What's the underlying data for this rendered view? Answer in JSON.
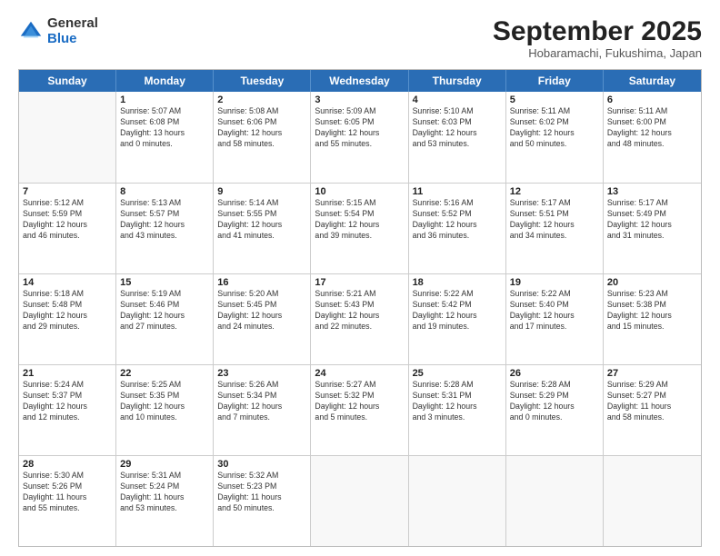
{
  "logo": {
    "general": "General",
    "blue": "Blue"
  },
  "title": "September 2025",
  "subtitle": "Hobaramachi, Fukushima, Japan",
  "weekdays": [
    "Sunday",
    "Monday",
    "Tuesday",
    "Wednesday",
    "Thursday",
    "Friday",
    "Saturday"
  ],
  "weeks": [
    [
      {
        "day": "",
        "info": ""
      },
      {
        "day": "1",
        "info": "Sunrise: 5:07 AM\nSunset: 6:08 PM\nDaylight: 13 hours\nand 0 minutes."
      },
      {
        "day": "2",
        "info": "Sunrise: 5:08 AM\nSunset: 6:06 PM\nDaylight: 12 hours\nand 58 minutes."
      },
      {
        "day": "3",
        "info": "Sunrise: 5:09 AM\nSunset: 6:05 PM\nDaylight: 12 hours\nand 55 minutes."
      },
      {
        "day": "4",
        "info": "Sunrise: 5:10 AM\nSunset: 6:03 PM\nDaylight: 12 hours\nand 53 minutes."
      },
      {
        "day": "5",
        "info": "Sunrise: 5:11 AM\nSunset: 6:02 PM\nDaylight: 12 hours\nand 50 minutes."
      },
      {
        "day": "6",
        "info": "Sunrise: 5:11 AM\nSunset: 6:00 PM\nDaylight: 12 hours\nand 48 minutes."
      }
    ],
    [
      {
        "day": "7",
        "info": "Sunrise: 5:12 AM\nSunset: 5:59 PM\nDaylight: 12 hours\nand 46 minutes."
      },
      {
        "day": "8",
        "info": "Sunrise: 5:13 AM\nSunset: 5:57 PM\nDaylight: 12 hours\nand 43 minutes."
      },
      {
        "day": "9",
        "info": "Sunrise: 5:14 AM\nSunset: 5:55 PM\nDaylight: 12 hours\nand 41 minutes."
      },
      {
        "day": "10",
        "info": "Sunrise: 5:15 AM\nSunset: 5:54 PM\nDaylight: 12 hours\nand 39 minutes."
      },
      {
        "day": "11",
        "info": "Sunrise: 5:16 AM\nSunset: 5:52 PM\nDaylight: 12 hours\nand 36 minutes."
      },
      {
        "day": "12",
        "info": "Sunrise: 5:17 AM\nSunset: 5:51 PM\nDaylight: 12 hours\nand 34 minutes."
      },
      {
        "day": "13",
        "info": "Sunrise: 5:17 AM\nSunset: 5:49 PM\nDaylight: 12 hours\nand 31 minutes."
      }
    ],
    [
      {
        "day": "14",
        "info": "Sunrise: 5:18 AM\nSunset: 5:48 PM\nDaylight: 12 hours\nand 29 minutes."
      },
      {
        "day": "15",
        "info": "Sunrise: 5:19 AM\nSunset: 5:46 PM\nDaylight: 12 hours\nand 27 minutes."
      },
      {
        "day": "16",
        "info": "Sunrise: 5:20 AM\nSunset: 5:45 PM\nDaylight: 12 hours\nand 24 minutes."
      },
      {
        "day": "17",
        "info": "Sunrise: 5:21 AM\nSunset: 5:43 PM\nDaylight: 12 hours\nand 22 minutes."
      },
      {
        "day": "18",
        "info": "Sunrise: 5:22 AM\nSunset: 5:42 PM\nDaylight: 12 hours\nand 19 minutes."
      },
      {
        "day": "19",
        "info": "Sunrise: 5:22 AM\nSunset: 5:40 PM\nDaylight: 12 hours\nand 17 minutes."
      },
      {
        "day": "20",
        "info": "Sunrise: 5:23 AM\nSunset: 5:38 PM\nDaylight: 12 hours\nand 15 minutes."
      }
    ],
    [
      {
        "day": "21",
        "info": "Sunrise: 5:24 AM\nSunset: 5:37 PM\nDaylight: 12 hours\nand 12 minutes."
      },
      {
        "day": "22",
        "info": "Sunrise: 5:25 AM\nSunset: 5:35 PM\nDaylight: 12 hours\nand 10 minutes."
      },
      {
        "day": "23",
        "info": "Sunrise: 5:26 AM\nSunset: 5:34 PM\nDaylight: 12 hours\nand 7 minutes."
      },
      {
        "day": "24",
        "info": "Sunrise: 5:27 AM\nSunset: 5:32 PM\nDaylight: 12 hours\nand 5 minutes."
      },
      {
        "day": "25",
        "info": "Sunrise: 5:28 AM\nSunset: 5:31 PM\nDaylight: 12 hours\nand 3 minutes."
      },
      {
        "day": "26",
        "info": "Sunrise: 5:28 AM\nSunset: 5:29 PM\nDaylight: 12 hours\nand 0 minutes."
      },
      {
        "day": "27",
        "info": "Sunrise: 5:29 AM\nSunset: 5:27 PM\nDaylight: 11 hours\nand 58 minutes."
      }
    ],
    [
      {
        "day": "28",
        "info": "Sunrise: 5:30 AM\nSunset: 5:26 PM\nDaylight: 11 hours\nand 55 minutes."
      },
      {
        "day": "29",
        "info": "Sunrise: 5:31 AM\nSunset: 5:24 PM\nDaylight: 11 hours\nand 53 minutes."
      },
      {
        "day": "30",
        "info": "Sunrise: 5:32 AM\nSunset: 5:23 PM\nDaylight: 11 hours\nand 50 minutes."
      },
      {
        "day": "",
        "info": ""
      },
      {
        "day": "",
        "info": ""
      },
      {
        "day": "",
        "info": ""
      },
      {
        "day": "",
        "info": ""
      }
    ]
  ]
}
